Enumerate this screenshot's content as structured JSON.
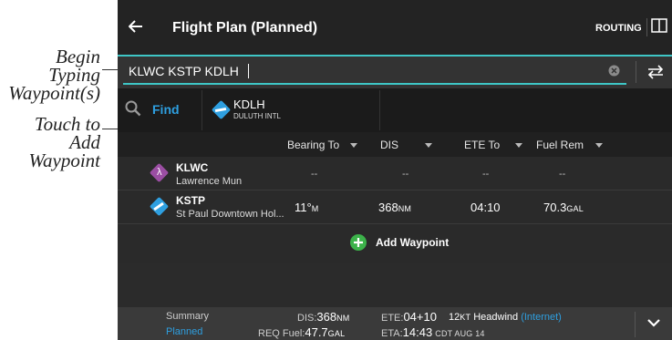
{
  "callouts": {
    "begin_typing": [
      "Begin Typing",
      "Waypoint(s)"
    ],
    "touch_to_add": [
      "Touch to Add",
      "Waypoint"
    ]
  },
  "header": {
    "back_icon": "arrow-left-icon",
    "title": "Flight Plan (Planned)",
    "routing_label": "ROUTING",
    "layout_icon": "split-panel-icon"
  },
  "search": {
    "value": "KLWC KSTP KDLH",
    "clear_icon": "clear-circle-icon",
    "swap_icon": "swap-direction-icon"
  },
  "find": {
    "search_icon": "magnifier-icon",
    "label": "Find",
    "result_code": "KDLH",
    "result_name": "DULUTH INTL"
  },
  "columns": {
    "bearing": "Bearing To",
    "dis": "DIS",
    "ete": "ETE To",
    "fuel": "Fuel Rem"
  },
  "waypoints": [
    {
      "code": "KLWC",
      "name": "Lawrence Mun",
      "bearing": "--",
      "bearing_unit": "",
      "dis": "--",
      "dis_unit": "",
      "ete": "--",
      "fuel": "--",
      "fuel_unit": "",
      "icon_color": "#9b4ea3"
    },
    {
      "code": "KSTP",
      "name": "St Paul Downtown Hol...",
      "bearing": "11°",
      "bearing_unit": "M",
      "dis": "368",
      "dis_unit": "NM",
      "ete": "04:10",
      "fuel": "70.3",
      "fuel_unit": "GAL",
      "icon_color": "#2e9fe0"
    }
  ],
  "add_waypoint": "Add Waypoint",
  "summary": {
    "label": "Summary",
    "status": "Planned",
    "dis_label": "DIS:",
    "dis_value": "368",
    "dis_unit": "NM",
    "req_fuel_label": "REQ Fuel:",
    "req_fuel_value": "47.7",
    "req_fuel_unit": "GAL",
    "ete_label": "ETE:",
    "ete_value": "04+10",
    "headwind_value": "12",
    "headwind_unit": "KT",
    "headwind_label": "Headwind",
    "source": "(Internet)",
    "eta_label": "ETA:",
    "eta_value": "14:43",
    "eta_suffix": "CDT AUG 14",
    "expand_icon": "chevron-down-icon"
  },
  "colors": {
    "accent": "#3ec6c6",
    "link": "#2e9fe0",
    "add": "#3cb24a"
  }
}
